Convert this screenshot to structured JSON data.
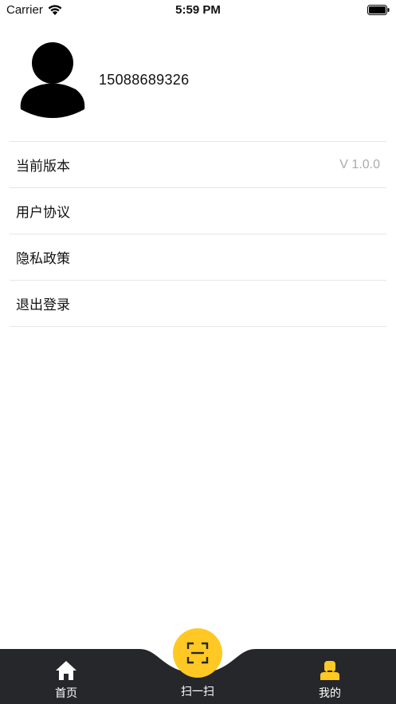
{
  "status_bar": {
    "carrier": "Carrier",
    "time": "5:59 PM"
  },
  "profile": {
    "phone": "15088689326"
  },
  "menu": [
    {
      "label": "当前版本",
      "value": "V 1.0.0"
    },
    {
      "label": "用户协议"
    },
    {
      "label": "隐私政策"
    },
    {
      "label": "退出登录"
    }
  ],
  "tabbar": {
    "home_label": "首页",
    "scan_label": "扫一扫",
    "mine_label": "我的",
    "background_color": "#26272b",
    "accent_color": "#ffc823",
    "icons": {
      "home": "home-icon",
      "scan": "scan-icon",
      "mine": "user-icon"
    }
  }
}
